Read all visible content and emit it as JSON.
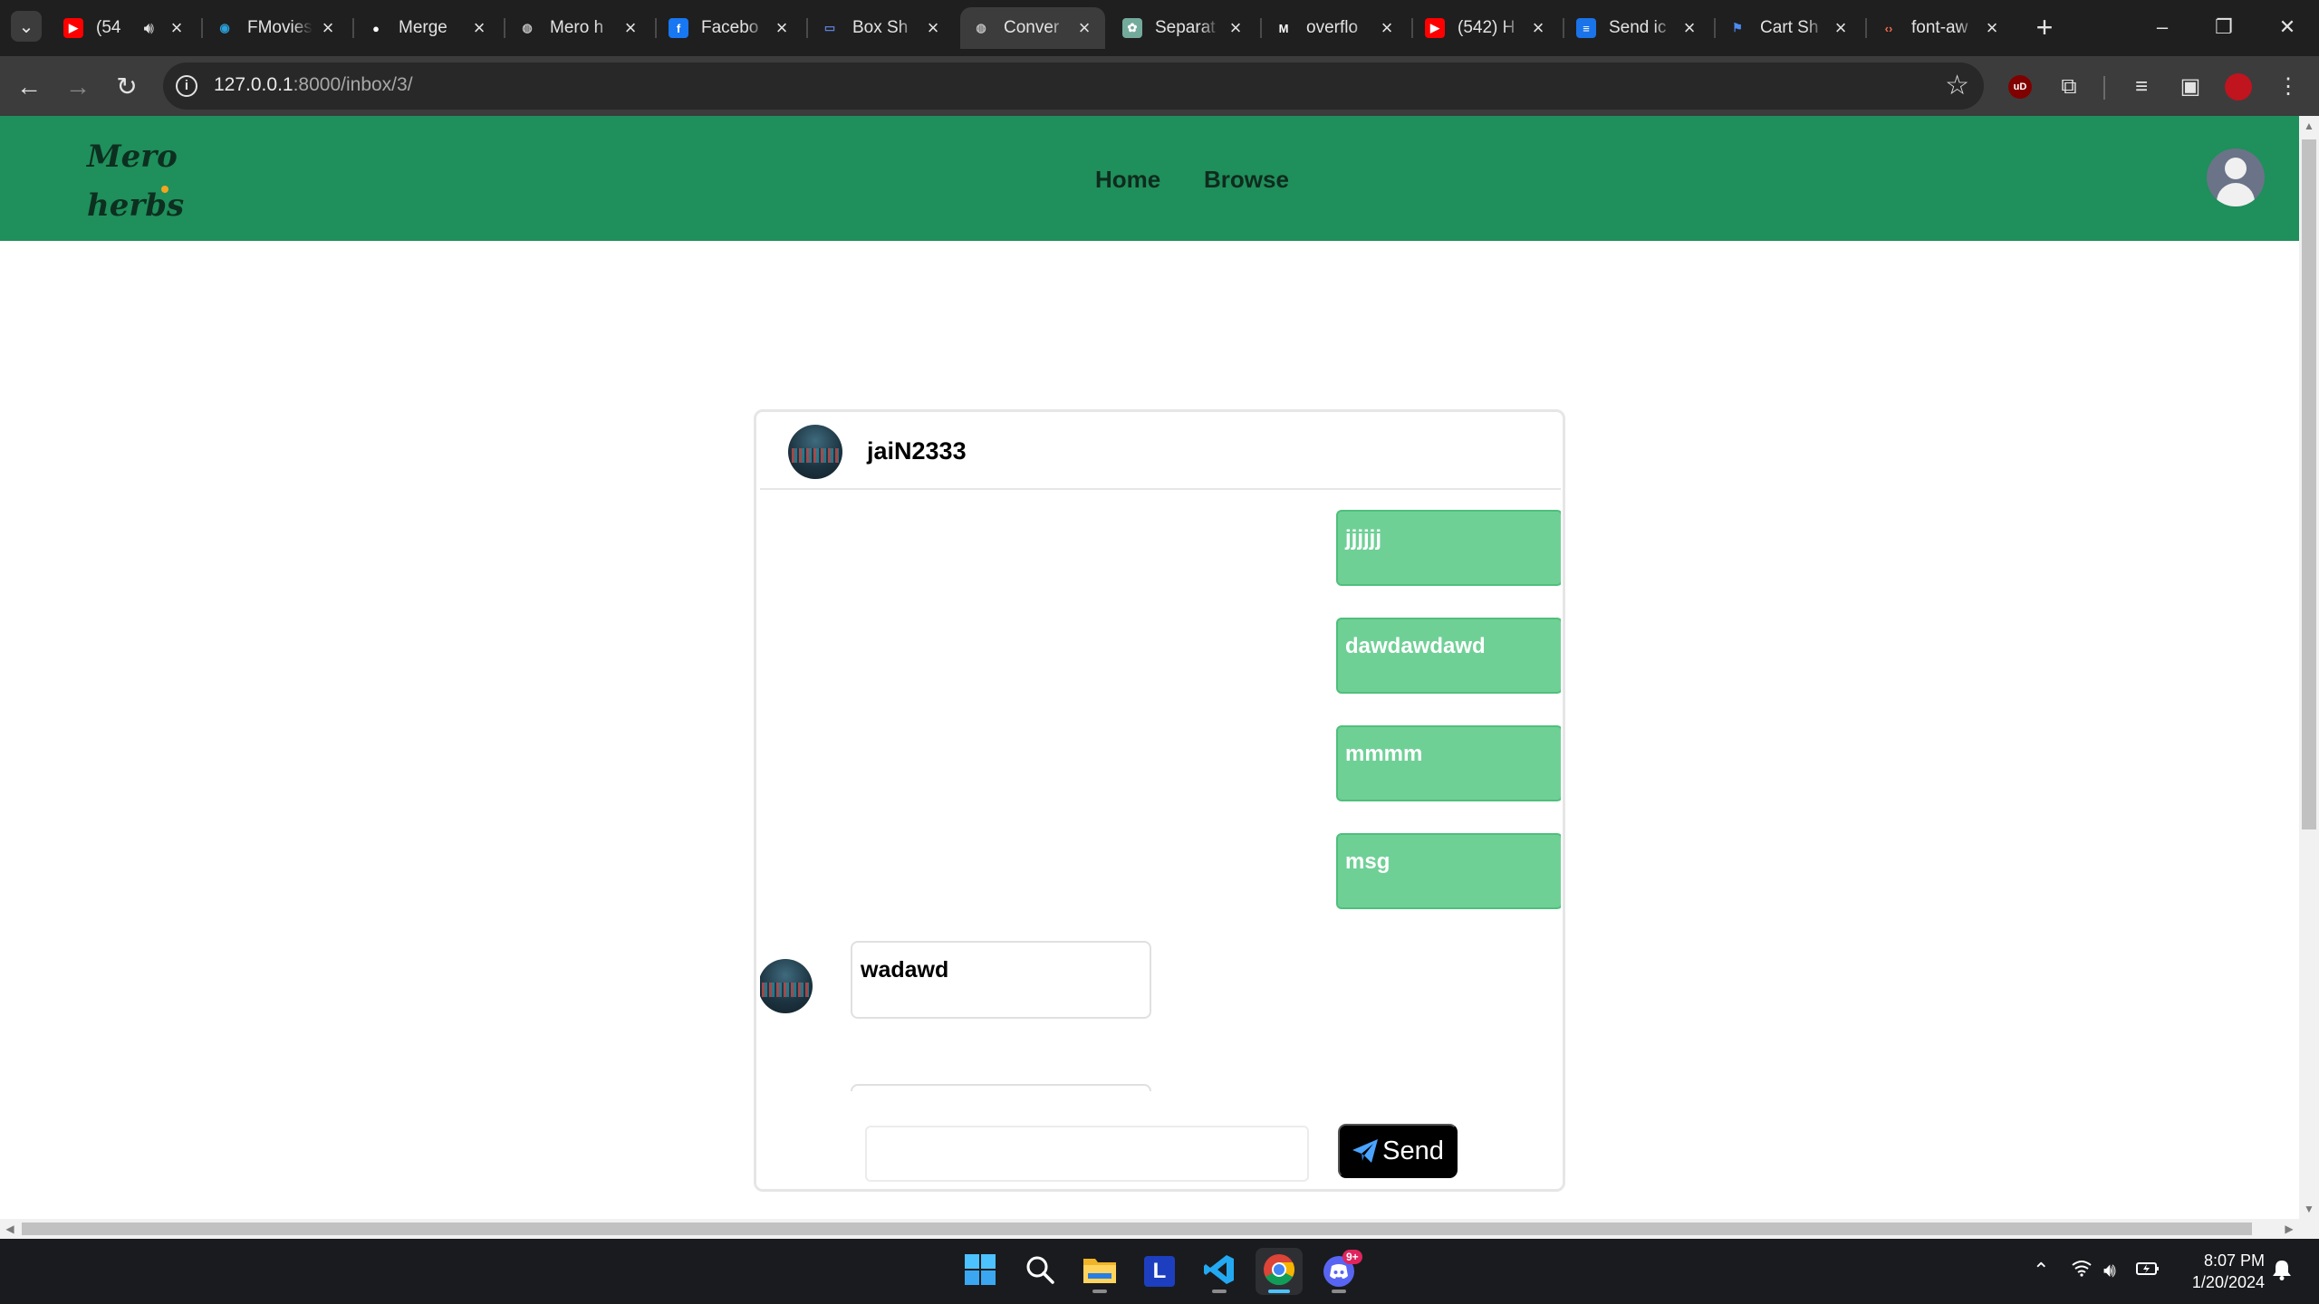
{
  "browser": {
    "tabs": [
      {
        "title": "(54",
        "favicon": "youtube-icon",
        "color": "#ff0000",
        "speaker": true
      },
      {
        "title": "FMovies",
        "favicon": "fmovies-icon",
        "color": "#2b9fd8"
      },
      {
        "title": "Merge",
        "favicon": "github-icon",
        "color": "#ffffff"
      },
      {
        "title": "Mero h",
        "favicon": "globe-icon",
        "color": "#bdbdbd"
      },
      {
        "title": "Facebo",
        "favicon": "facebook-icon",
        "color": "#1877f2"
      },
      {
        "title": "Box Sh",
        "favicon": "page-icon",
        "color": "#5c7fd6"
      },
      {
        "title": "Conver",
        "favicon": "globe-icon",
        "color": "#bdbdbd",
        "active": true
      },
      {
        "title": "Separat",
        "favicon": "chatgpt-icon",
        "color": "#74aa9c"
      },
      {
        "title": "overflo",
        "favicon": "medium-icon",
        "color": "#ffffff"
      },
      {
        "title": "(542) H",
        "favicon": "youtube-icon",
        "color": "#ff0000"
      },
      {
        "title": "Send ic",
        "favicon": "forms-icon",
        "color": "#1a73e8"
      },
      {
        "title": "Cart Sh",
        "favicon": "flag-icon",
        "color": "#4c8bf5"
      },
      {
        "title": "font-aw",
        "favicon": "code-icon",
        "color": "#f26a4b"
      }
    ],
    "url_host": "127.0.0.1",
    "url_path": ":8000/inbox/3/",
    "ublock_label": "uD"
  },
  "site": {
    "logo_line1": "Mero",
    "logo_line2": "herbs",
    "nav": [
      "Home",
      "Browse"
    ],
    "brand_color": "#1f8f5b"
  },
  "chat": {
    "contact_name": "jaiN2333",
    "messages": [
      {
        "direction": "sent",
        "text": "jjjjjj"
      },
      {
        "direction": "sent",
        "text": "dawdawdawd"
      },
      {
        "direction": "sent",
        "text": "mmmm"
      },
      {
        "direction": "sent",
        "text": "msg"
      },
      {
        "direction": "received",
        "text": "wadawd"
      }
    ],
    "composer_placeholder": "",
    "send_label": "Send",
    "sent_color": "#6fd096"
  },
  "taskbar": {
    "apps": [
      "windows-start-icon",
      "search-icon",
      "file-explorer-icon",
      "l-app-icon",
      "vscode-icon",
      "chrome-icon",
      "discord-icon"
    ],
    "discord_badge": "9+",
    "time": "8:07 PM",
    "date": "1/20/2024"
  }
}
